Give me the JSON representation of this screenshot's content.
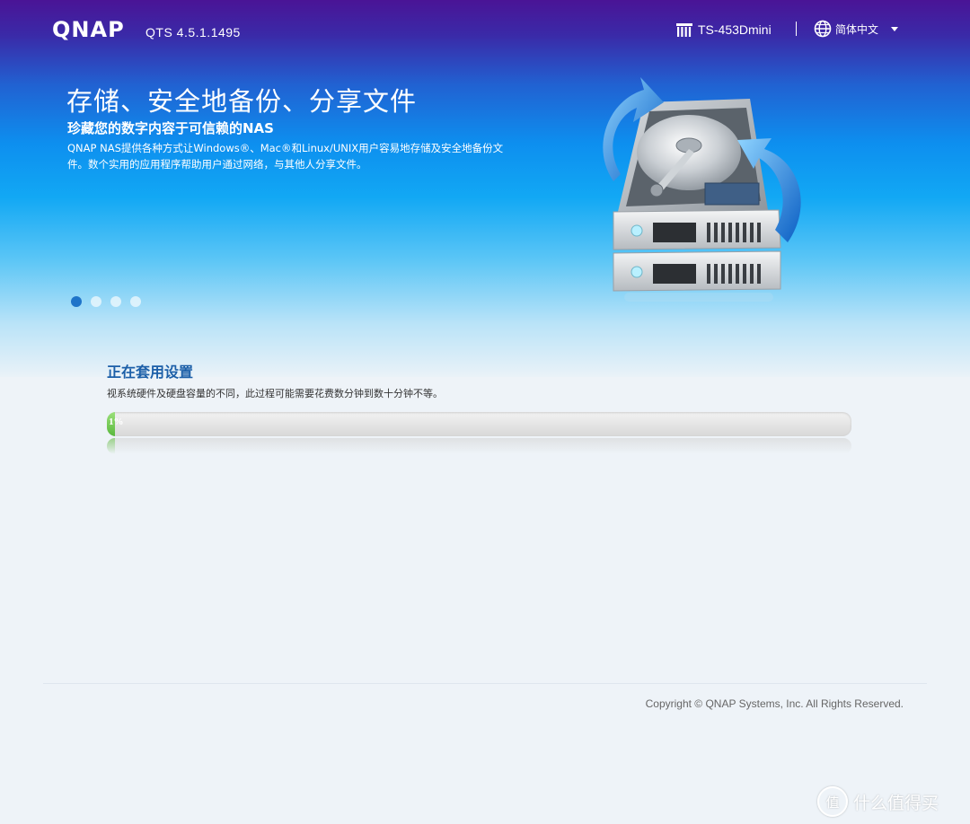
{
  "header": {
    "logo": "QNAP",
    "version": "QTS 4.5.1.1495",
    "model": "TS-453Dmini",
    "language": "简体中文"
  },
  "hero": {
    "headline": "存储、安全地备份、分享文件",
    "subheadline": "珍藏您的数字内容于可信赖的NAS",
    "description": "QNAP NAS提供各种方式让Windows®、Mac®和Linux/UNIX用户容易地存储及安全地备份文件。数个实用的应用程序帮助用户通过网络，与其他人分享文件。",
    "carousel_dots": 4,
    "active_dot": 0
  },
  "setup": {
    "title": "正在套用设置",
    "description": "视系统硬件及硬盘容量的不同，此过程可能需要花费数分钟到数十分钟不等。",
    "progress_percent": 1,
    "progress_label": "1%"
  },
  "footer": {
    "copyright": "Copyright © QNAP Systems, Inc. All Rights Reserved."
  },
  "watermark": {
    "badge": "值",
    "text": "什么值得买"
  },
  "colors": {
    "accent": "#1c5fa8",
    "progress_fill": "#58b83c",
    "active_dot": "#1f74c9"
  }
}
